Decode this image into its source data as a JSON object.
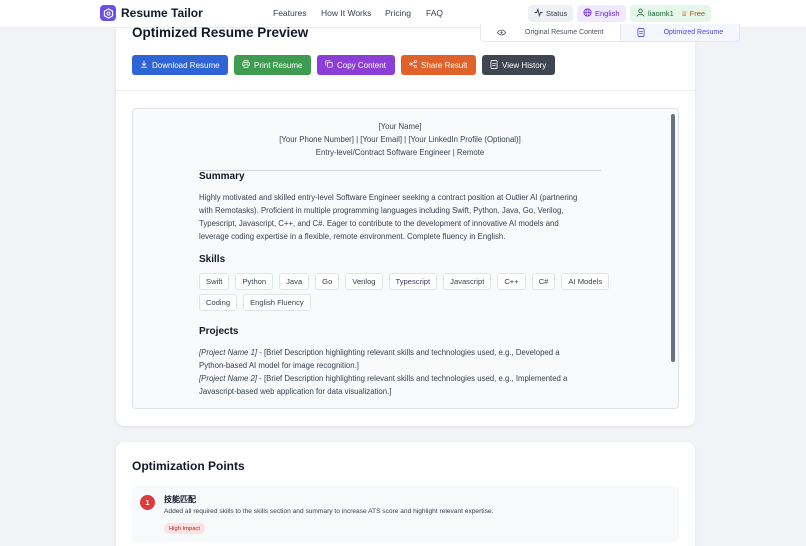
{
  "brand": {
    "name": "Resume Tailor",
    "logo_icon": "gear-hex-icon",
    "accent": "#6d4ee6"
  },
  "nav": {
    "items": [
      "Features",
      "How It Works",
      "Pricing",
      "FAQ"
    ]
  },
  "header": {
    "status_label": "Status",
    "language_label": "English",
    "username": "liaomk1",
    "plan": "Free"
  },
  "preview": {
    "title": "Optimized Resume Preview",
    "toggle": {
      "original": "Original Resume Content",
      "optimized": "Optimized Resume",
      "selected": "optimized"
    },
    "buttons": {
      "download": "Download Resume",
      "print": "Print Resume",
      "copy": "Copy Content",
      "share": "Share Result",
      "history": "View History"
    }
  },
  "resume": {
    "name": "[Your Name]",
    "contact": "[Your Phone Number] | [Your Email] | [Your LinkedIn Profile (Optional)]",
    "role": "Entry-level/Contract Software Engineer | Remote",
    "summary_heading": "Summary",
    "summary_lines": [
      "Highly motivated and skilled entry-level Software Engineer seeking a contract position at Outlier AI (partnering",
      "with Remotasks). Proficient in multiple programming languages including Swift, Python, Java, Go, Verilog,",
      "Typescript, Javascript, C++, and C#. Eager to contribute to the development of innovative AI models and",
      "leverage coding expertise in a flexible, remote environment. Complete fluency in English."
    ],
    "skills_heading": "Skills",
    "skills": [
      "Swift",
      "Python",
      "Java",
      "Go",
      "Verilog",
      "Typescript",
      "Javascript",
      "C++",
      "C#",
      "AI Models",
      "Coding",
      "English Fluency"
    ],
    "projects_heading": "Projects",
    "projects": [
      {
        "name": "[Project Name 1]",
        "line1": " - [Brief Description highlighting relevant skills and technologies used, e.g., Developed a",
        "line2": "Python-based AI model for image recognition.]"
      },
      {
        "name": "[Project Name 2]",
        "line1": " - [Brief Description highlighting relevant skills and technologies used, e.g., Implemented a",
        "line2": "Javascript-based web application for data visualization.]"
      }
    ]
  },
  "optimization": {
    "title": "Optimization Points",
    "items": [
      {
        "number": "1",
        "heading": "技能匹配",
        "description": "Added all required skills to the skills section and summary to increase ATS score and highlight relevant expertise.",
        "impact": "High Impact"
      }
    ]
  }
}
